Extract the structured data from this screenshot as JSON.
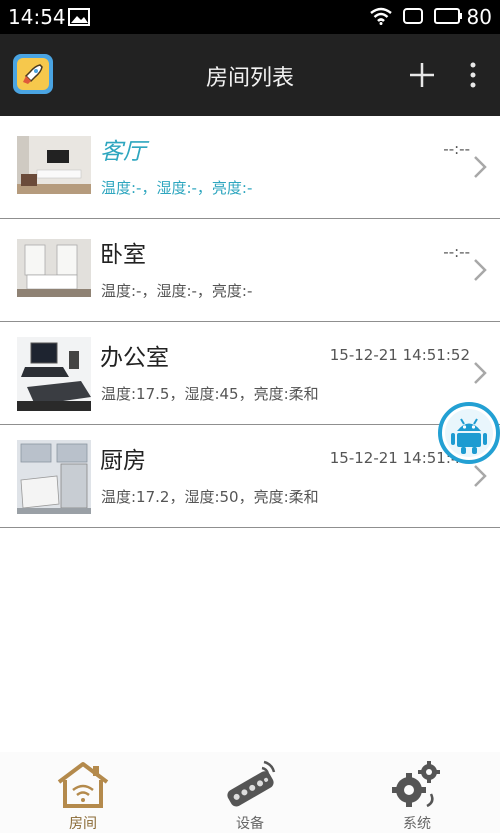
{
  "status_bar": {
    "time": "14:54",
    "battery": "80"
  },
  "header": {
    "title": "房间列表"
  },
  "rooms": [
    {
      "name": "客厅",
      "time": "--:--",
      "stats": "温度:-，湿度:-，亮度:-"
    },
    {
      "name": "卧室",
      "time": "--:--",
      "stats": "温度:-，湿度:-，亮度:-"
    },
    {
      "name": "办公室",
      "time": "15-12-21 14:51:52",
      "stats": "温度:17.5，湿度:45，亮度:柔和"
    },
    {
      "name": "厨房",
      "time": "15-12-21 14:51:45",
      "stats": "温度:17.2，湿度:50，亮度:柔和"
    }
  ],
  "tabs": [
    {
      "label": "房间",
      "icon": "house-icon"
    },
    {
      "label": "设备",
      "icon": "remote-icon"
    },
    {
      "label": "系统",
      "icon": "gears-icon"
    }
  ],
  "colors": {
    "accent": "#2ea6bf",
    "appbar": "#222222",
    "active_tab": "#8a6a35"
  }
}
